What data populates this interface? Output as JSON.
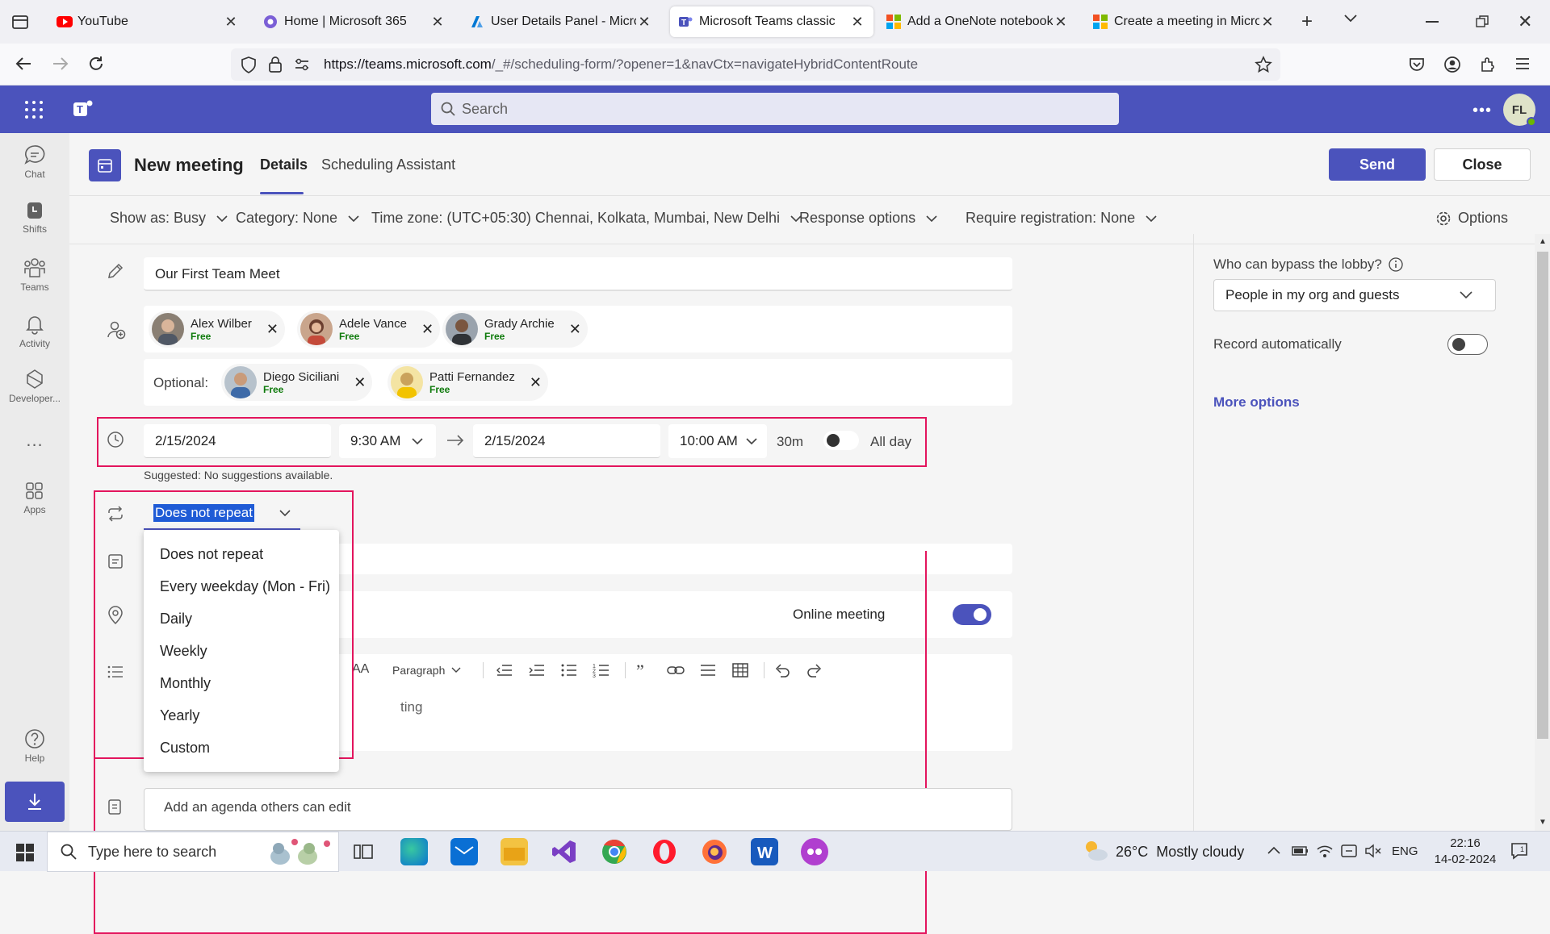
{
  "browser": {
    "tabs": [
      {
        "title": "YouTube",
        "icon": "youtube-icon",
        "color": "#ff0000"
      },
      {
        "title": "Home | Microsoft 365",
        "icon": "m365-icon",
        "color": "#7b5fd6"
      },
      {
        "title": "User Details Panel - Microso",
        "icon": "azure-icon",
        "color": "#0078d4"
      },
      {
        "title": "Microsoft Teams classic",
        "icon": "teams-icon",
        "color": "#4b53bc",
        "active": true
      },
      {
        "title": "Add a OneNote notebook in",
        "icon": "microsoft-icon",
        "color": "#f25022"
      },
      {
        "title": "Create a meeting in Microso",
        "icon": "microsoft-icon",
        "color": "#f25022"
      }
    ],
    "new_tab": "+",
    "url_host": "https://teams.microsoft.com",
    "url_path": "/_#/scheduling-form/?opener=1&navCtx=navigateHybridContentRoute"
  },
  "teams_header": {
    "search_placeholder": "Search",
    "avatar_initials": "FL"
  },
  "rail": [
    {
      "label": "Chat",
      "icon": "chat-icon"
    },
    {
      "label": "Shifts",
      "icon": "shifts-icon"
    },
    {
      "label": "Teams",
      "icon": "teams-icon"
    },
    {
      "label": "Activity",
      "icon": "bell-icon"
    },
    {
      "label": "Developer...",
      "icon": "developer-icon"
    },
    {
      "label": "...",
      "icon": "more-icon"
    },
    {
      "label": "Apps",
      "icon": "apps-icon"
    },
    {
      "label": "Help",
      "icon": "help-icon"
    }
  ],
  "meeting_header": {
    "title": "New meeting",
    "tab_details": "Details",
    "tab_scheduling": "Scheduling Assistant",
    "send_label": "Send",
    "close_label": "Close"
  },
  "toolbar": {
    "show_as": "Show as: Busy",
    "category": "Category: None",
    "time_zone": "Time zone: (UTC+05:30) Chennai, Kolkata, Mumbai, New Delhi",
    "response_options": "Response options",
    "require_registration": "Require registration: None",
    "options": "Options"
  },
  "form": {
    "title_value": "Our First Team Meet",
    "required_attendees": [
      {
        "name": "Alex Wilber",
        "status": "Free"
      },
      {
        "name": "Adele Vance",
        "status": "Free"
      },
      {
        "name": "Grady Archie",
        "status": "Free"
      }
    ],
    "optional_label": "Optional:",
    "optional_attendees": [
      {
        "name": "Diego Siciliani",
        "status": "Free"
      },
      {
        "name": "Patti Fernandez",
        "status": "Free"
      }
    ],
    "start_date": "2/15/2024",
    "start_time": "9:30 AM",
    "end_date": "2/15/2024",
    "end_time": "10:00 AM",
    "duration": "30m",
    "all_day_label": "All day",
    "suggestion": "Suggested: No suggestions available.",
    "repeat_value": "Does not repeat",
    "repeat_options": [
      "Does not repeat",
      "Every weekday (Mon - Fri)",
      "Daily",
      "Weekly",
      "Monthly",
      "Yearly",
      "Custom"
    ],
    "online_meeting_label": "Online meeting",
    "editor_paragraph": "Paragraph",
    "editor_fontsize_glyph": "AA",
    "editor_partial_text": "ting",
    "agenda_placeholder": "Add an agenda others can edit"
  },
  "right_panel": {
    "lobby_label": "Who can bypass the lobby?",
    "lobby_value": "People in my org and guests",
    "record_label": "Record automatically",
    "more_options": "More options"
  },
  "taskbar": {
    "search_placeholder": "Type here to search",
    "weather": "26°C  Mostly cloudy",
    "language": "ENG",
    "time": "22:16",
    "date": "14-02-2024"
  },
  "colors": {
    "teams_purple": "#4b53bc",
    "highlight_red": "#e3155d",
    "free_green": "#0e7a0b"
  }
}
